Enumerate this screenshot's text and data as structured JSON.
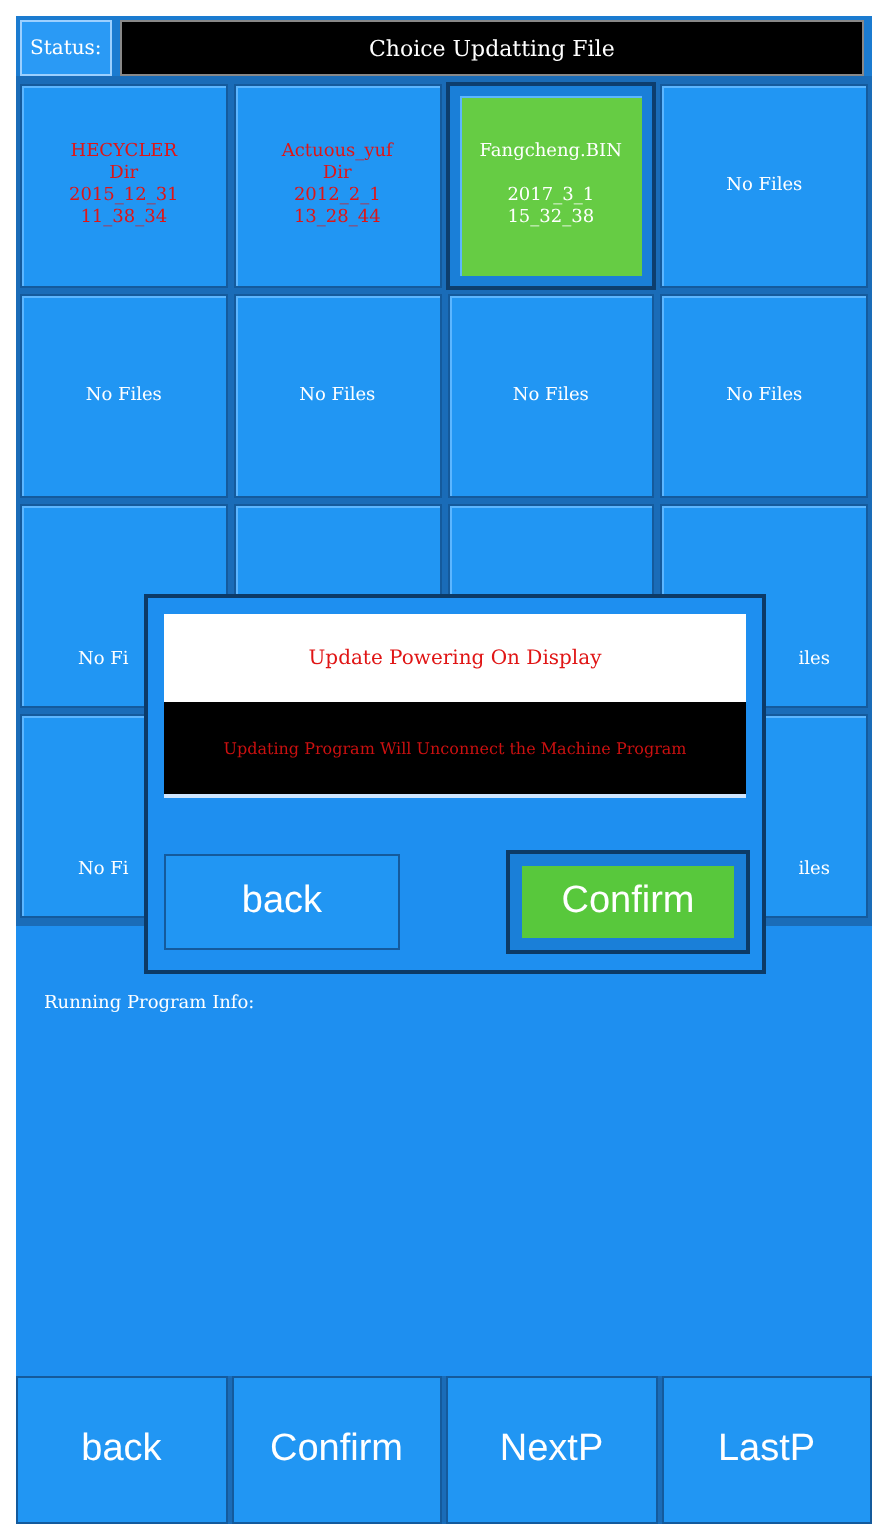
{
  "status_bar": {
    "label": "Status:",
    "title": "Choice Updatting File"
  },
  "files": [
    {
      "lines": [
        "HECYCLER",
        "Dir",
        "2015_12_31",
        "11_38_34"
      ],
      "kind": "dir",
      "selected": false
    },
    {
      "lines": [
        "Actuous_yuf",
        "Dir",
        "2012_2_1",
        "13_28_44"
      ],
      "kind": "dir",
      "selected": false
    },
    {
      "lines": [
        "Fangcheng.BIN",
        "2017_3_1",
        "15_32_38"
      ],
      "kind": "file",
      "selected": true
    },
    {
      "lines": [
        "No Files"
      ],
      "kind": "empty",
      "selected": false
    },
    {
      "lines": [
        "No Files"
      ],
      "kind": "empty",
      "selected": false
    },
    {
      "lines": [
        "No Files"
      ],
      "kind": "empty",
      "selected": false
    },
    {
      "lines": [
        "No Files"
      ],
      "kind": "empty",
      "selected": false
    },
    {
      "lines": [
        "No Files"
      ],
      "kind": "empty",
      "selected": false
    },
    {
      "lines": [
        "No Fi"
      ],
      "kind": "empty",
      "selected": false
    },
    {
      "kind": "empty",
      "selected": false
    },
    {
      "kind": "empty",
      "selected": false
    },
    {
      "lines": [
        "iles"
      ],
      "kind": "empty",
      "selected": false
    },
    {
      "lines": [
        "No Fi"
      ],
      "kind": "empty",
      "selected": false
    },
    {
      "kind": "empty"
    },
    {
      "kind": "empty"
    },
    {
      "lines": [
        "iles"
      ],
      "kind": "empty",
      "selected": false
    }
  ],
  "dialog": {
    "title": "Update Powering On Display",
    "message": "Updating Program Will Unconnect the Machine Program",
    "buttons": [
      {
        "label": "back",
        "selected": false
      },
      {
        "label": "Confirm",
        "selected": true
      }
    ]
  },
  "info": {
    "label": "Running Program Info:"
  },
  "buttons": [
    "back",
    "Confirm",
    "NextP",
    "LastP"
  ]
}
